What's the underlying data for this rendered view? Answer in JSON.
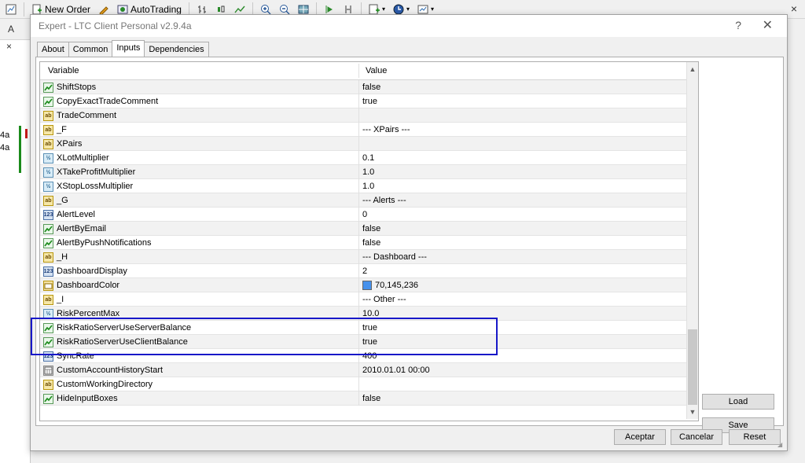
{
  "toolbar": {
    "new_order_label": "New Order",
    "autotrading_label": "AutoTrading",
    "close_glyph": "×"
  },
  "background_chart": {
    "header_glyph": "A",
    "close_glyph": "×",
    "label_1": "4a",
    "label_2": "4a"
  },
  "dialog": {
    "title": "Expert - LTC Client Personal v2.9.4a",
    "help_glyph": "?",
    "close_glyph": "✕",
    "tabs": [
      {
        "label": "About"
      },
      {
        "label": "Common"
      },
      {
        "label": "Inputs"
      },
      {
        "label": "Dependencies"
      }
    ],
    "active_tab": "Inputs",
    "grid": {
      "col_variable": "Variable",
      "col_value": "Value",
      "rows": [
        {
          "type": "bool",
          "icon_text": "",
          "name": "ShiftStops",
          "value": "false"
        },
        {
          "type": "bool",
          "icon_text": "",
          "name": "CopyExactTradeComment",
          "value": "true"
        },
        {
          "type": "str",
          "icon_text": "ab",
          "name": "TradeComment",
          "value": ""
        },
        {
          "type": "str",
          "icon_text": "ab",
          "name": "_F",
          "value": "--- XPairs ---"
        },
        {
          "type": "str",
          "icon_text": "ab",
          "name": "XPairs",
          "value": ""
        },
        {
          "type": "dbl",
          "icon_text": "½",
          "name": "XLotMultiplier",
          "value": "0.1"
        },
        {
          "type": "dbl",
          "icon_text": "½",
          "name": "XTakeProfitMultiplier",
          "value": "1.0"
        },
        {
          "type": "dbl",
          "icon_text": "½",
          "name": "XStopLossMultiplier",
          "value": "1.0"
        },
        {
          "type": "str",
          "icon_text": "ab",
          "name": "_G",
          "value": "--- Alerts ---"
        },
        {
          "type": "int",
          "icon_text": "123",
          "name": "AlertLevel",
          "value": "0"
        },
        {
          "type": "bool",
          "icon_text": "",
          "name": "AlertByEmail",
          "value": "false"
        },
        {
          "type": "bool",
          "icon_text": "",
          "name": "AlertByPushNotifications",
          "value": "false"
        },
        {
          "type": "str",
          "icon_text": "ab",
          "name": "_H",
          "value": "--- Dashboard ---"
        },
        {
          "type": "int",
          "icon_text": "123",
          "name": "DashboardDisplay",
          "value": "2"
        },
        {
          "type": "color",
          "icon_text": "",
          "name": "DashboardColor",
          "value": "70,145,236",
          "swatch": "#4691ec"
        },
        {
          "type": "str",
          "icon_text": "ab",
          "name": "_I",
          "value": "--- Other ---"
        },
        {
          "type": "dbl",
          "icon_text": "½",
          "name": "RiskPercentMax",
          "value": "10.0"
        },
        {
          "type": "bool",
          "icon_text": "",
          "name": "RiskRatioServerUseServerBalance",
          "value": "true"
        },
        {
          "type": "bool",
          "icon_text": "",
          "name": "RiskRatioServerUseClientBalance",
          "value": "true"
        },
        {
          "type": "int",
          "icon_text": "123",
          "name": "SyncRate",
          "value": "400"
        },
        {
          "type": "dt",
          "icon_text": "",
          "name": "CustomAccountHistoryStart",
          "value": "2010.01.01 00:00"
        },
        {
          "type": "str",
          "icon_text": "ab",
          "name": "CustomWorkingDirectory",
          "value": ""
        },
        {
          "type": "bool",
          "icon_text": "",
          "name": "HideInputBoxes",
          "value": "false"
        }
      ]
    },
    "load_label": "Load",
    "save_label": "Save",
    "accept_label": "Aceptar",
    "cancel_label": "Cancelar",
    "reset_label": "Reset"
  },
  "colors": {
    "highlight_border": "#1818c8",
    "dashboard_color": "#4691ec"
  }
}
